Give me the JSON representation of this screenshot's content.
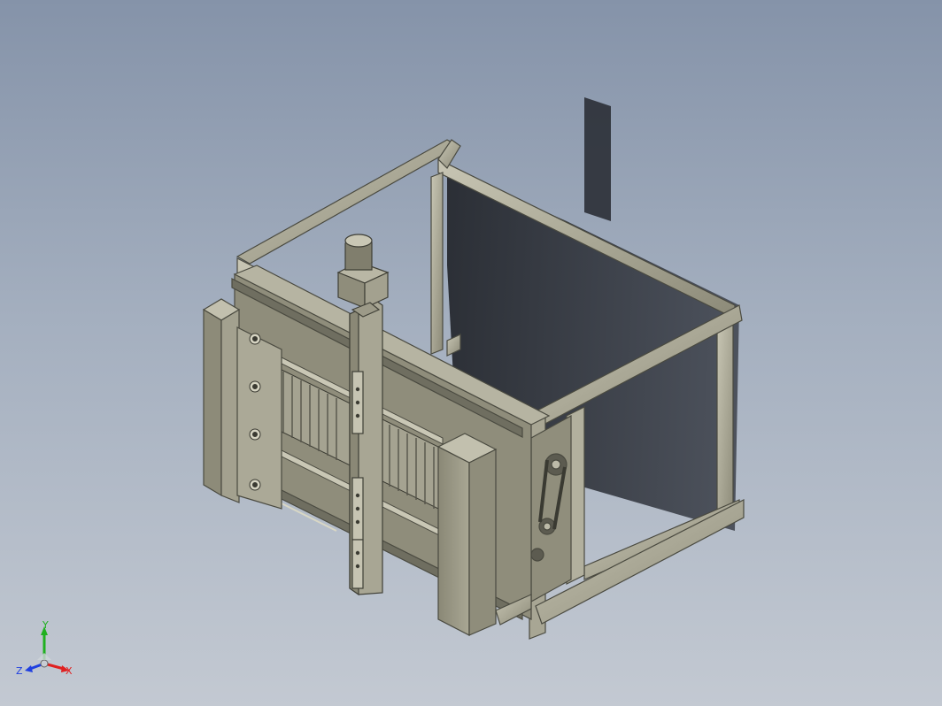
{
  "triad": {
    "x_label": "X",
    "y_label": "Y",
    "z_label": "Z",
    "x_color": "#e02020",
    "y_color": "#20b020",
    "z_color": "#2040e0"
  },
  "colors": {
    "background_top": "#8593a9",
    "background_bottom": "#c3c9d2",
    "metal": "#9a9886",
    "metal_dark": "#6f6e60",
    "metal_light": "#c4c2b0",
    "shadow": "#2a2d33"
  }
}
